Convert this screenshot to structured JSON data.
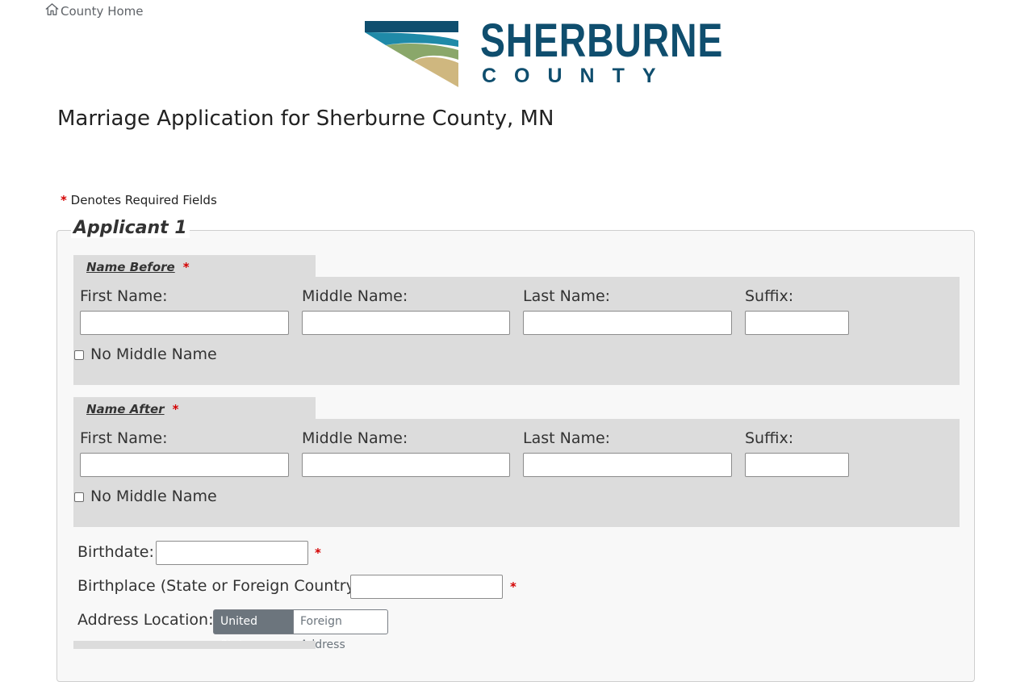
{
  "topnav": {
    "home_link": "County Home"
  },
  "logo": {
    "word": "SHERBURNE",
    "sub": "COUNTY",
    "colors": {
      "navy": "#0f4e6e",
      "teal": "#1f8aa8",
      "green": "#8aa76a",
      "tan": "#cfb77f"
    }
  },
  "page": {
    "title": "Marriage Application for Sherburne County, MN",
    "required_asterisk": "*",
    "required_note": "Denotes Required Fields"
  },
  "applicant": {
    "legend": "Applicant 1",
    "name_before": {
      "heading": "Name Before",
      "fields": {
        "first": "First Name:",
        "middle": "Middle Name:",
        "last": "Last Name:",
        "suffix": "Suffix:"
      },
      "values": {
        "first": "",
        "middle": "",
        "last": "",
        "suffix": ""
      },
      "no_middle": "No Middle Name"
    },
    "name_after": {
      "heading": "Name After",
      "fields": {
        "first": "First Name:",
        "middle": "Middle Name:",
        "last": "Last Name:",
        "suffix": "Suffix:"
      },
      "values": {
        "first": "",
        "middle": "",
        "last": "",
        "suffix": ""
      },
      "no_middle": "No Middle Name"
    },
    "birthdate_label": "Birthdate:",
    "birthdate_value": "",
    "birthplace_label": "Birthplace (State or Foreign Country):",
    "birthplace_value": "",
    "address_location_label": "Address Location:",
    "address_options": [
      "United States",
      "Foreign Address"
    ],
    "address_selected": "United States"
  }
}
